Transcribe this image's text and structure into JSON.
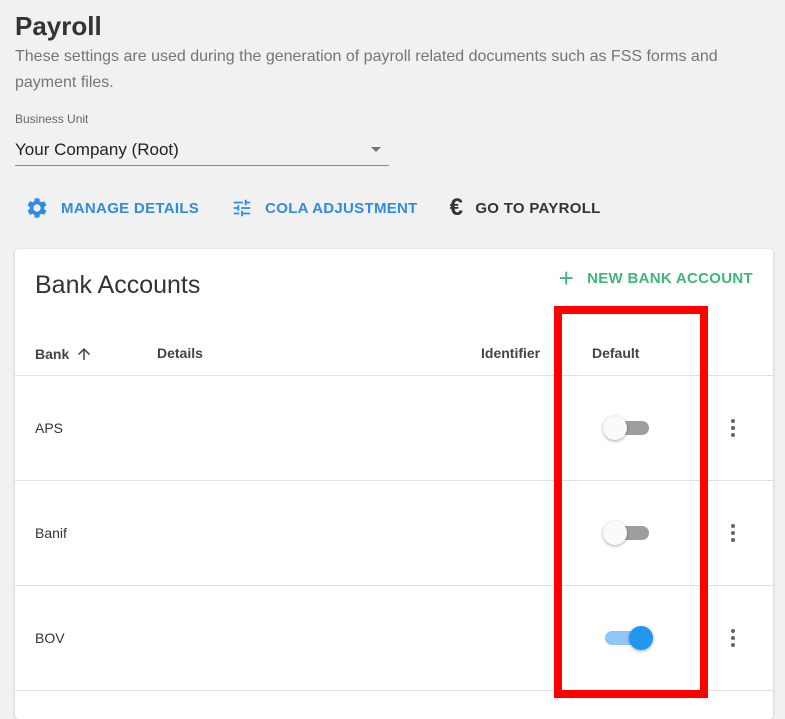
{
  "page": {
    "title": "Payroll",
    "description": "These settings are used during the generation of payroll related documents such as FSS forms and payment files."
  },
  "business_unit": {
    "label": "Business Unit",
    "value": "Your Company (Root)"
  },
  "actions": {
    "manage_details": "MANAGE DETAILS",
    "cola_adjustment": "COLA ADJUSTMENT",
    "go_to_payroll": "GO TO PAYROLL",
    "euro_symbol": "€"
  },
  "bank_accounts": {
    "title": "Bank Accounts",
    "new_button": "NEW BANK ACCOUNT",
    "columns": {
      "bank": "Bank",
      "details": "Details",
      "identifier": "Identifier",
      "default": "Default"
    },
    "rows": [
      {
        "bank": "APS",
        "default": false
      },
      {
        "bank": "Banif",
        "default": false
      },
      {
        "bank": "BOV",
        "default": true
      }
    ]
  },
  "colors": {
    "accent_blue": "#2f8be8",
    "accent_green": "#3cb878",
    "highlight_red": "#ff0000"
  },
  "icons": {
    "manage": "gear-icon",
    "cola": "sliders-icon",
    "payroll": "euro-icon",
    "sort": "arrow-up-icon",
    "row_menu": "more-vertical-icon",
    "add": "plus-icon"
  }
}
